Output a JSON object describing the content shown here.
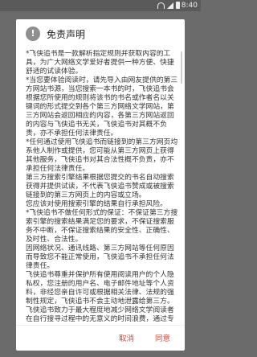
{
  "status_bar": {
    "time": "8:40",
    "icons": [
      "wifi-icon",
      "signal-icon",
      "battery-icon"
    ]
  },
  "dialog": {
    "icon": "info-icon",
    "title": "免责声明",
    "paragraphs": [
      "*飞侠追书是一款解析指定规则并获取内容的工具，为广大网络文学爱好者提供一种方便、快捷舒适的试读体验。",
      "*当您要体验阅读时，请先导入由网友提供的第三方网站书源，当您搜索一本书的时，飞侠追书会根据您所使用的规则将该书的书名或作者名以关键词的形式提交到各个第三方网络文学网站，第三方网站会返回相应的内容，各第三方网站返回的内容与飞侠追书无关，飞侠追书对其概不负责，亦不承担任何法律责任。",
      "*任何通过使用飞侠追书而链接到的第三方网页均系他人制作或提供，您可能从第三方网页上获得其他服务，飞侠追书对其合法性概不负责，亦不承担任何法律责任。",
      "第三方搜索引擎结果根据您提交的书名自动搜索获得并提供试读，不代表飞侠追书赞成或被搜索链接到的第三方网页上的内容或立场。",
      "您应该对使用搜索引擎的结果自行承担风险。",
      "*飞侠追书不做任何形式的保证：不保证第三方搜索引擎的搜索结果满足您的要求，不保证搜索服务不中断，不保证搜索结果的安全性、正确性、及时性、合法性。",
      "因网络状况、通讯线路、第三方网站等任何原因而导致您不能正常使用，飞侠追书不承担任何法律责任。",
      "飞侠追书尊重并保护所有使用阅读用户的个人隐私权，您注册的用户名、电子邮件地址等个人资料，非经您亲自许可或根据相关法律、法规的强制性规定，飞侠追书不会主动地泄露给第三方。",
      "飞侠追书致力于最大程度地减少网络文学阅读者在自行搜寻过程中的无意义的时间浪费，通过专业搜索展示不同网站中网络文学的最新章节。飞侠追书在为广大小说爱好者提供方便、快捷舒适的试读体验的同时，也使优秀网络文学得以迅速、更广泛的传播，从而达到了在一定程度促进网络文学充分繁荣发展之目的。"
    ],
    "cancel_label": "取消",
    "agree_label": "同意"
  }
}
